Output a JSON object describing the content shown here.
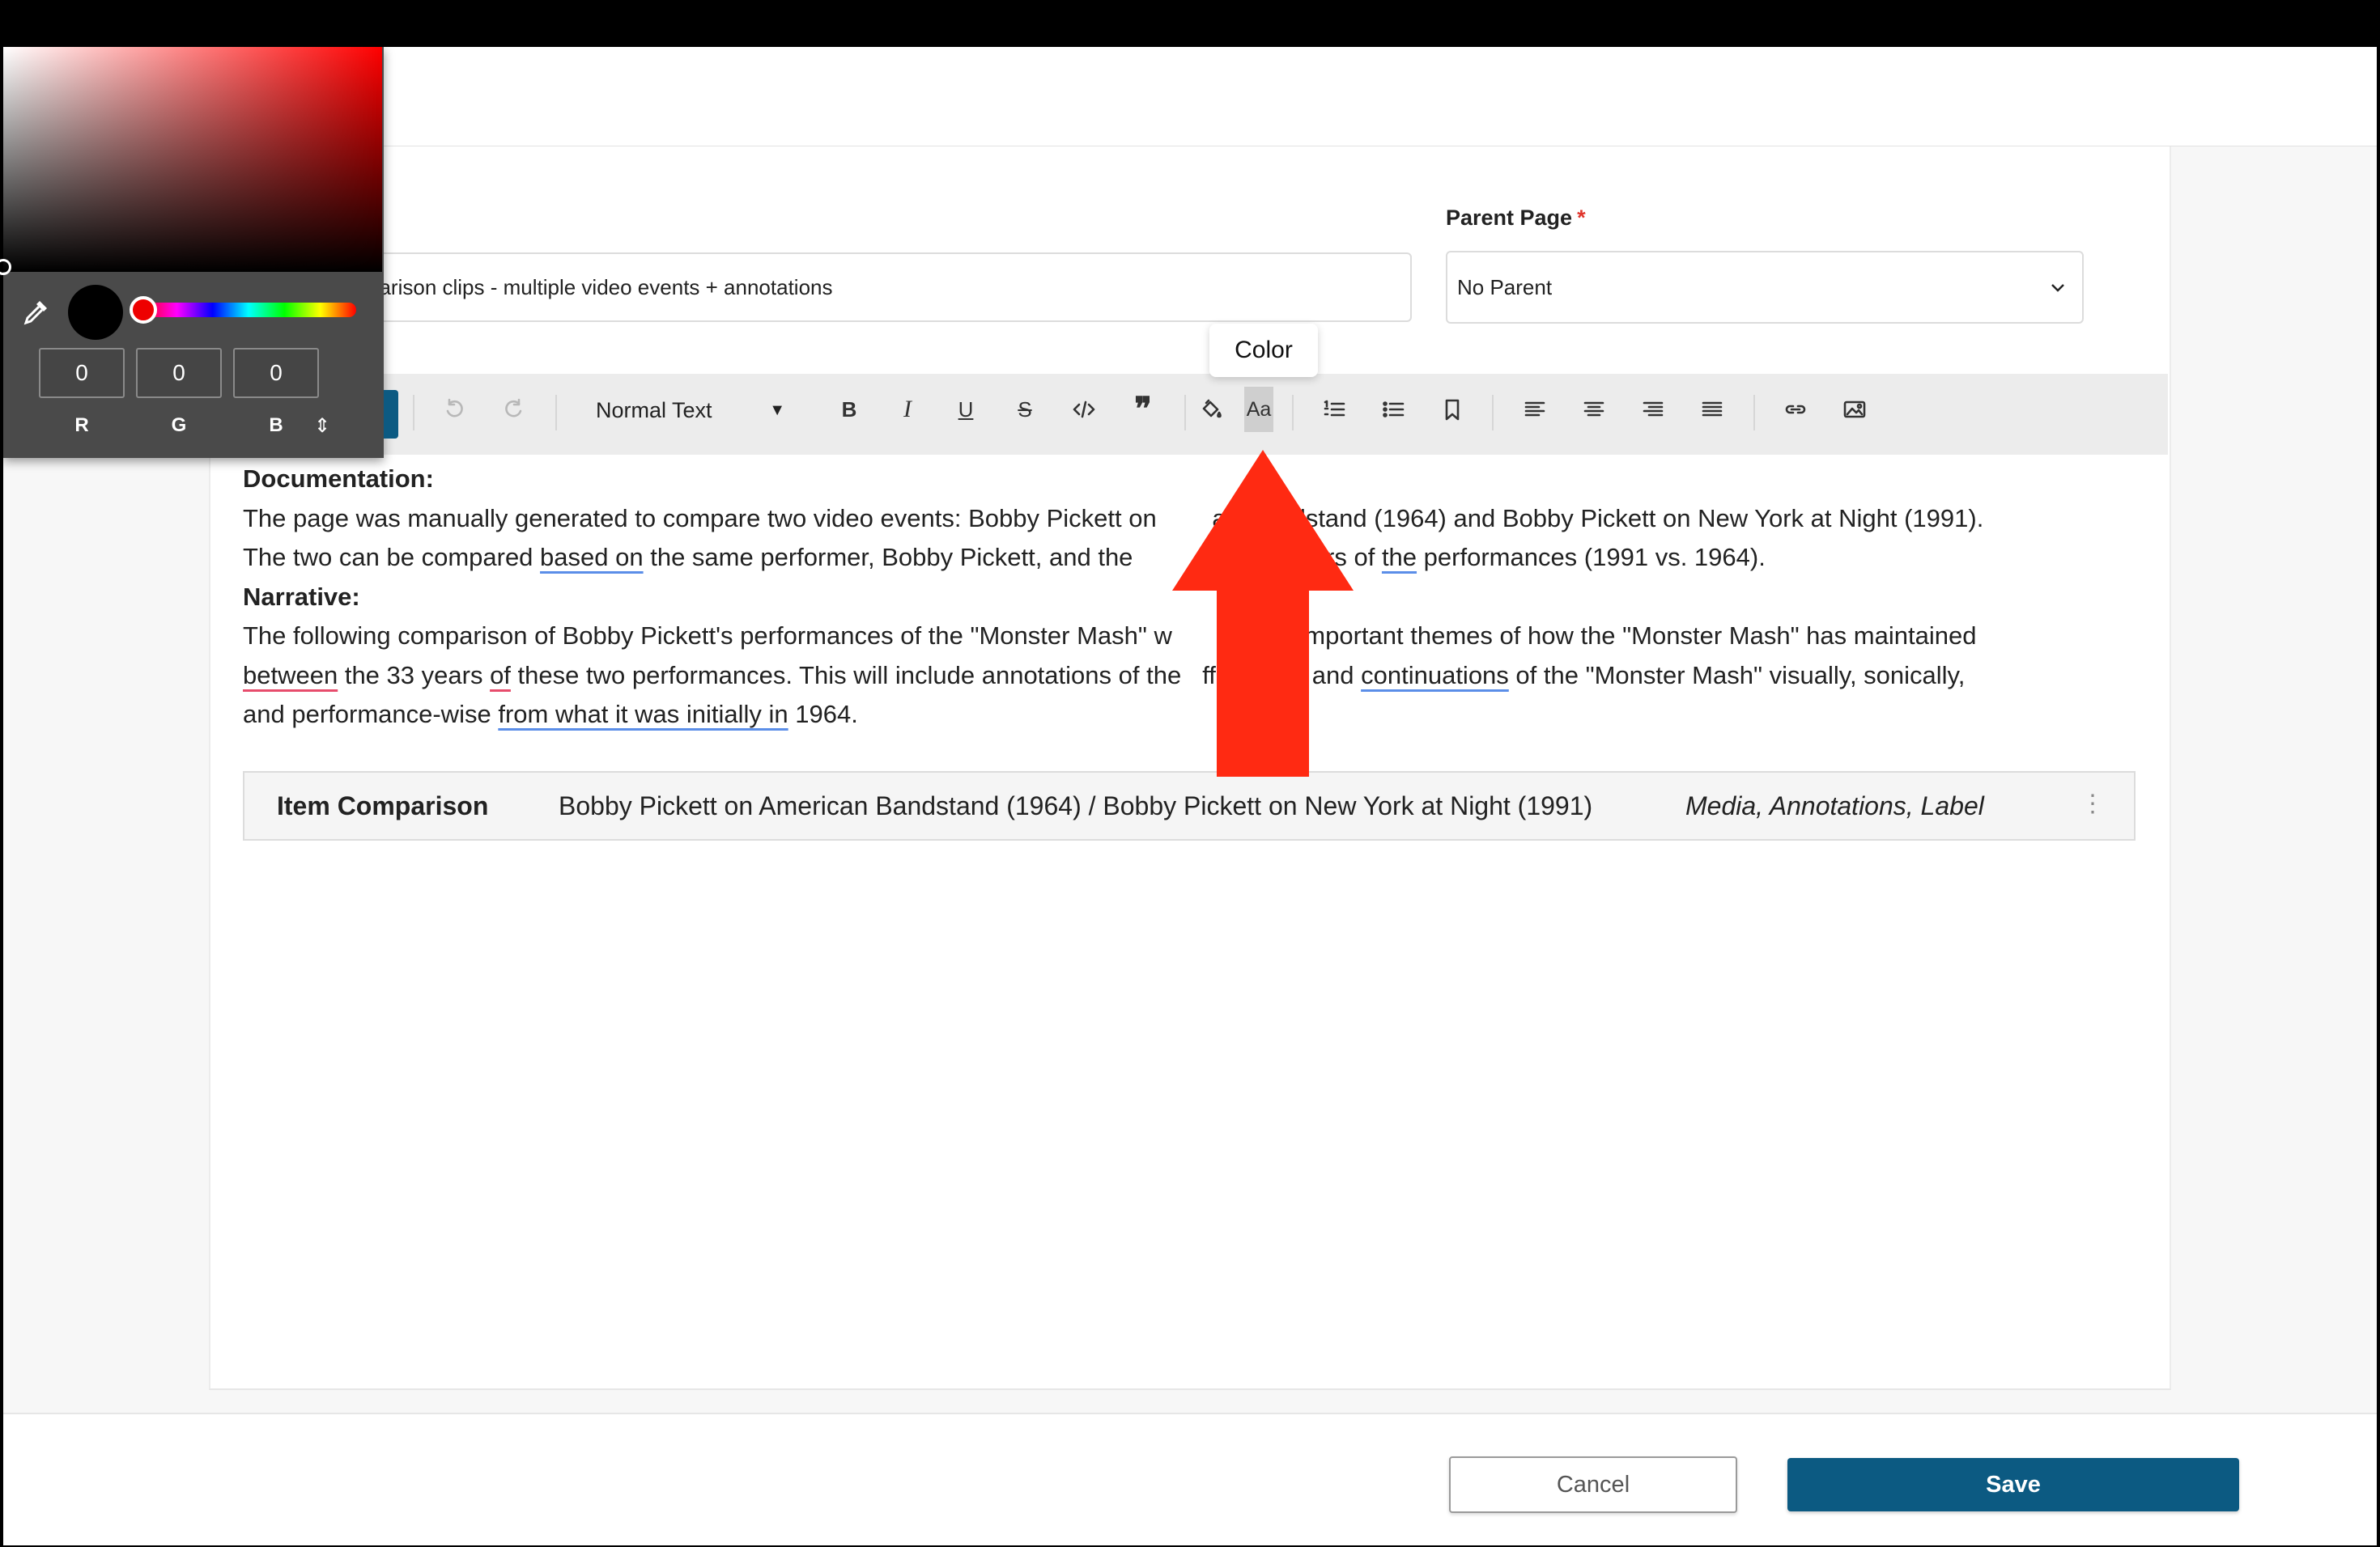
{
  "form": {
    "title_value": "parison clips - multiple video events + annotations",
    "parent_label": "Parent Page",
    "parent_required_mark": "*",
    "parent_value": "No Parent"
  },
  "toolbar": {
    "format_value": "Normal Text",
    "bold_label": "B",
    "italic_label": "I",
    "underline_label": "U",
    "strike_label": "S",
    "color_label": "Aa",
    "tooltip": "Color"
  },
  "content": {
    "doc_heading": "Documentation:",
    "p1_a": "The page was manually generated to compare two video events: Bobby Pickett on ",
    "p1_b": "an Bandstand (1964) and Bobby Pickett on New York at Night (1991).",
    "p2_a": "The two can be compared ",
    "p2_u1": "based on",
    "p2_b": " the same performer, Bobby Pickett, and the ",
    "p2_c": "years of ",
    "p2_u2": "the",
    "p2_d": " performances (1991 vs. 1964).",
    "narr_heading": "Narrative:",
    "p3": "The following comparison of Bobby Pickett's performances of the \"Monster Mash\" w",
    "p3_b": "eature important themes of how the \"Monster Mash\" has maintained",
    "p4_u1": "between",
    "p4_a": " the 33 years ",
    "p4_u2": "of",
    "p4_b": " these two performances. This will include annotations of the",
    "p4_c": "fferences and ",
    "p4_u3": "continuations",
    "p4_d": " of the \"Monster Mash\" visually, sonically,",
    "p5_a": "and performance-wise ",
    "p5_u1": "from what it was initially in",
    "p5_b": " 1964."
  },
  "comparison": {
    "title": "Item Comparison",
    "items": "Bobby Pickett on American Bandstand (1964) / Bobby Pickett on New York at Night (1991)",
    "tags": "Media, Annotations, Label",
    "menu_icon": "⋮"
  },
  "color_picker": {
    "r": "0",
    "g": "0",
    "b": "0",
    "r_label": "R",
    "g_label": "G",
    "b_label": "B",
    "mode_icon": "⇕",
    "current_color": "#000000",
    "hue_color": "#ff0000"
  },
  "actions": {
    "cancel": "Cancel",
    "save": "Save"
  },
  "colors": {
    "primary": "#0c5a82",
    "annotation_arrow": "#ff2a12",
    "required": "#e0342b"
  }
}
